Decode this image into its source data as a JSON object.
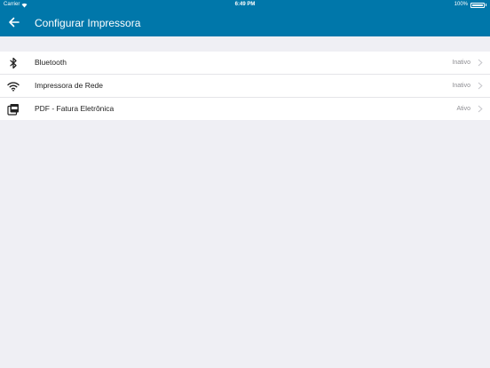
{
  "status_bar": {
    "carrier": "Carrier",
    "time": "6:49 PM",
    "battery": "100%"
  },
  "header": {
    "title": "Configurar Impressora",
    "background": "#0077aa"
  },
  "printers": [
    {
      "label": "Bluetooth",
      "status": "Inativo",
      "icon": "bluetooth-icon"
    },
    {
      "label": "Impressora de Rede",
      "status": "Inativo",
      "icon": "wifi-icon"
    },
    {
      "label": "PDF - Fatura Eletrônica",
      "status": "Ativo",
      "icon": "pdf-icon"
    }
  ]
}
